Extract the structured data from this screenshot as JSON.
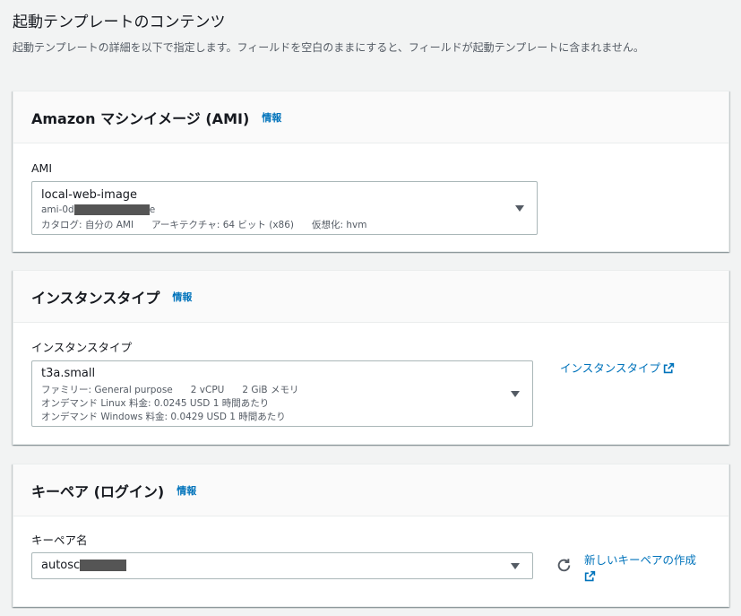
{
  "page": {
    "title": "起動テンプレートのコンテンツ",
    "description": "起動テンプレートの詳細を以下で指定します。フィールドを空白のままにすると、フィールドが起動テンプレートに含まれません。"
  },
  "ami_section": {
    "title": "Amazon マシンイメージ (AMI)",
    "info": "情報",
    "field_label": "AMI",
    "selected_name": "local-web-image",
    "selected_id_prefix": "ami-0d",
    "selected_id_suffix": "e",
    "catalog": "カタログ: 自分の AMI",
    "architecture": "アーキテクチャ: 64 ビット (x86)",
    "virtualization": "仮想化: hvm"
  },
  "instance_section": {
    "title": "インスタンスタイプ",
    "info": "情報",
    "field_label": "インスタンスタイプ",
    "selected": "t3a.small",
    "family": "ファミリー: General purpose",
    "vcpu": "2 vCPU",
    "memory": "2 GiB メモリ",
    "linux_price": "オンデマンド Linux 料金: 0.0245 USD 1 時間あたり",
    "windows_price": "オンデマンド Windows 料金: 0.0429 USD 1 時間あたり",
    "side_link": "インスタンスタイプ"
  },
  "keypair_section": {
    "title": "キーペア (ログイン)",
    "info": "情報",
    "field_label": "キーペア名",
    "selected_prefix": "autosc",
    "create_link": "新しいキーペアの作成"
  },
  "colors": {
    "link": "#0073bb",
    "border": "#aab7b8",
    "background": "#f2f3f3"
  }
}
